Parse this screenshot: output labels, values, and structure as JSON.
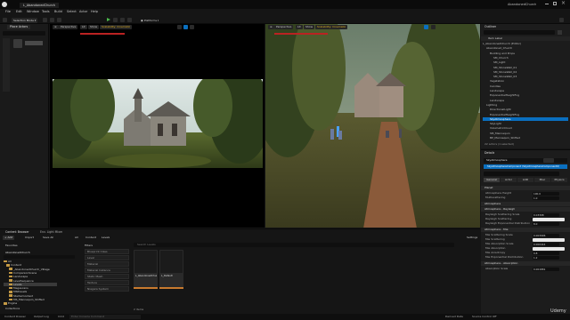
{
  "title_bar": {
    "project_tab": "L_AbandonedChurch",
    "project_name": "AbandonedChurch"
  },
  "menu": [
    "File",
    "Edit",
    "Window",
    "Tools",
    "Build",
    "Select",
    "Actor",
    "Help"
  ],
  "toolbar": {
    "mode": "Selection Mode",
    "platforms": "Platforms"
  },
  "place_actors": {
    "title": "Place Actors"
  },
  "viewport_left": {
    "perspective": "Perspective",
    "lit": "Lit",
    "show": "Show",
    "scalability": "Scalability: Cinematic"
  },
  "viewport_right": {
    "perspective": "Perspective",
    "lit": "Lit",
    "show": "Show",
    "scalability": "Scalability: Cinematic"
  },
  "outliner": {
    "title": "Outliner",
    "column": "Item Label",
    "rows": [
      "L_AbandonedChurch (Editor)",
      "Abandoned_Church",
      "Building and Props",
      "SM_Church",
      "SM_Light",
      "SM_StoneWall_01",
      "SM_StoneWall_02",
      "SM_StoneWall_03",
      "Vegetation",
      "Candles",
      "Landscape",
      "ExponentialHeightFog",
      "Landscape",
      "Lighting",
      "DirectionalLight",
      "ExponentialHeightFog",
      "SkyAtmosphere",
      "SkyLight",
      "VolumetricCloud",
      "SM_Mannequin",
      "BP_Mannequin_Shifted"
    ],
    "count": "22 actors (1 selected)"
  },
  "details": {
    "title": "Details",
    "actor": "SkyAtmosphere",
    "component": "SkyAtmosphereComponent (SkyAtmosphereComponent0)",
    "tabs": [
      "General",
      "Actor",
      "LOD",
      "Misc",
      "Physics"
    ],
    "sections": [
      "Planet",
      "Atmosphere",
      "Atmosphere - Rayleigh",
      "Atmosphere - Mie",
      "Atmosphere - Absorption"
    ],
    "rows": [
      {
        "label": "Atmosphere Height",
        "value": "100.0"
      },
      {
        "label": "Multiscattering",
        "value": "1.0"
      },
      {
        "label": "Rayleigh Scattering Scale",
        "value": "0.03308"
      },
      {
        "label": "Rayleigh Scattering",
        "value": ""
      },
      {
        "label": "Rayleigh Exponential Distribution",
        "value": "8.0"
      },
      {
        "label": "Mie Scattering Scale",
        "value": "0.003996"
      },
      {
        "label": "Mie Scattering",
        "value": ""
      },
      {
        "label": "Mie Absorption Scale",
        "value": "0.000444"
      },
      {
        "label": "Mie Absorption",
        "value": ""
      },
      {
        "label": "Mie Anisotropy",
        "value": "0.8"
      },
      {
        "label": "Mie Exponential Distribution",
        "value": "1.2"
      },
      {
        "label": "Absorption Scale",
        "value": "0.001881"
      }
    ]
  },
  "content_browser": {
    "tabs": [
      "Content Browser",
      "Env. Light Mixer"
    ],
    "add": "Add",
    "import": "Import",
    "save_all": "Save All",
    "path": [
      "All",
      "Content",
      "Levels"
    ],
    "settings": "Settings",
    "favorites": "Favorites",
    "project": "AbandonedChurch",
    "folders": [
      "All",
      "Content",
      "_AbandonedChurch_Village",
      "CompanionScene",
      "Landscape",
      "LevelSequence",
      "Levels",
      "Megascans",
      "MSPresets",
      "StarterContent",
      "MS_Mannequin_Shifted",
      "Engine"
    ],
    "filters_title": "Filters",
    "filters": [
      "Blueprint Class",
      "Level",
      "Material",
      "Material Instance",
      "Static Mesh",
      "Texture",
      "Niagara System"
    ],
    "search_placeholder": "Search Levels",
    "assets": [
      {
        "name": "L_AbandonedChurch",
        "type": "Level"
      },
      {
        "name": "L_Default",
        "type": "Level"
      }
    ],
    "item_count": "2 items"
  },
  "status_bar": {
    "collections": "Collections",
    "content_drawer": "Content Drawer",
    "output_log": "Output Log",
    "cmd": "Cmd",
    "console_placeholder": "Enter Console Command",
    "derived_data": "Derived Data",
    "source_control": "Source Control Off",
    "watermark": "Udemy"
  },
  "colors": {
    "accent": "#2a8ae0",
    "folder": "#c59a45",
    "selected": "#0a6fbf",
    "asset_bar": "#c87a2e"
  }
}
